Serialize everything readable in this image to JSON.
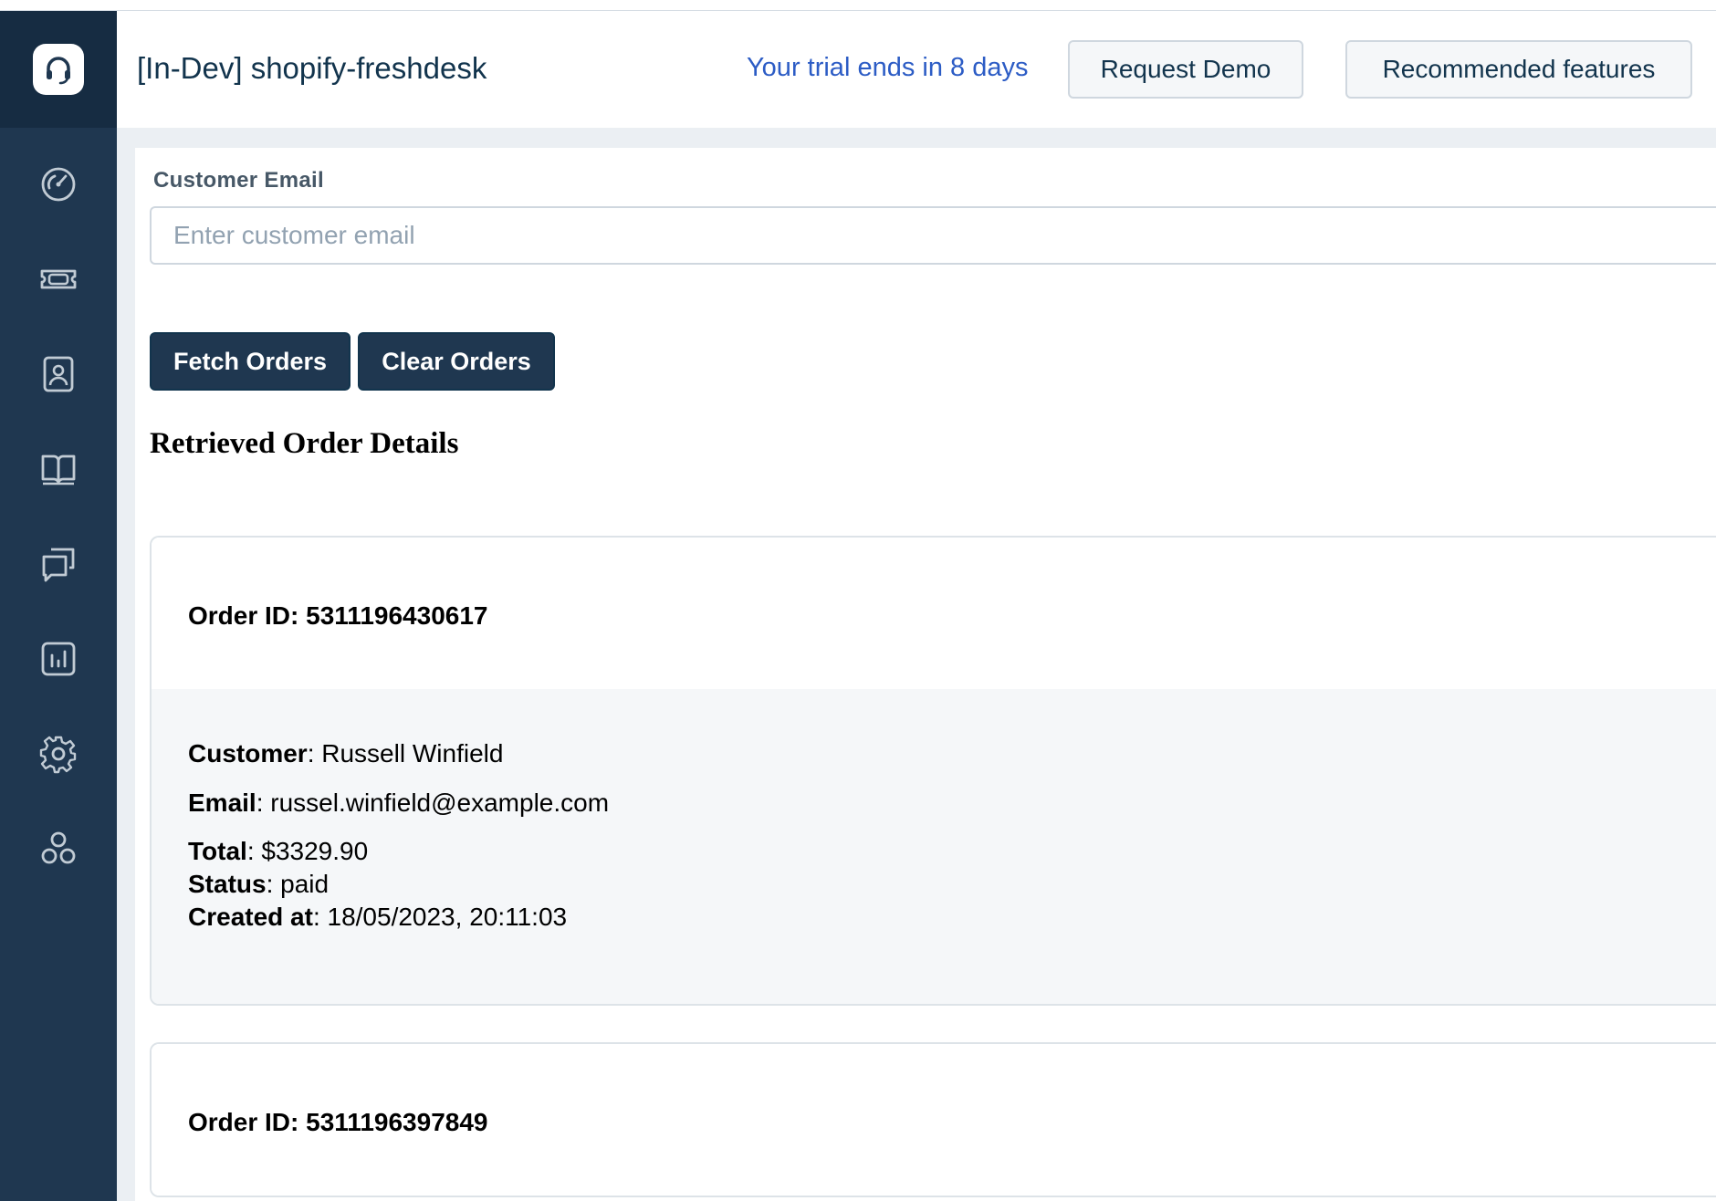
{
  "header": {
    "app_title": "[In-Dev] shopify-freshdesk",
    "trial_text": "Your trial ends in 8 days",
    "request_demo_label": "Request Demo",
    "recommended_label": "Recommended features"
  },
  "sidebar": {
    "items": [
      {
        "icon": "dashboard-icon"
      },
      {
        "icon": "ticket-icon"
      },
      {
        "icon": "contacts-icon"
      },
      {
        "icon": "knowledge-base-icon"
      },
      {
        "icon": "discussions-icon"
      },
      {
        "icon": "reports-icon"
      },
      {
        "icon": "settings-icon"
      },
      {
        "icon": "apps-icon"
      }
    ]
  },
  "form": {
    "email_label": "Customer Email",
    "email_placeholder": "Enter customer email",
    "email_value": "",
    "fetch_label": "Fetch Orders",
    "clear_label": "Clear Orders"
  },
  "section_title": "Retrieved Order Details",
  "orders": [
    {
      "order_id_text": "Order ID: 5311196430617",
      "customer_label": "Customer",
      "customer_value": ": Russell Winfield",
      "email_label": "Email",
      "email_value": ": russel.winfield@example.com",
      "total_label": "Total",
      "total_value": ": $3329.90",
      "status_label": "Status",
      "status_value": ": paid",
      "created_label": "Created at",
      "created_value": ": 18/05/2023, 20:11:03"
    },
    {
      "order_id_text": "Order ID: 5311196397849"
    }
  ],
  "colors": {
    "sidebar": "#1f3750",
    "sidebar_logo_bg": "#162c42",
    "primary_button": "#1f3750",
    "trial_link": "#2c5cc5"
  }
}
